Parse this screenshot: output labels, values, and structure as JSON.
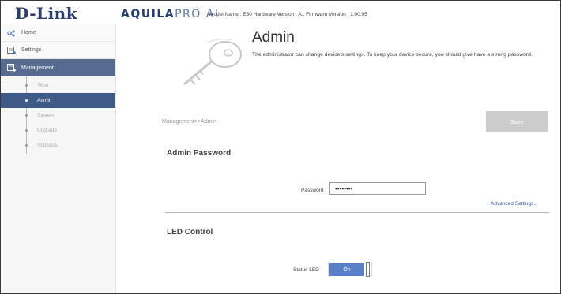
{
  "header": {
    "logo": "D-Link",
    "brand_main": "AQUILA",
    "brand_pro": "PRO AI",
    "model_info": "Model Name : E30 Hardware Version : A1 Firmware Version : 1.00.05"
  },
  "sidebar": {
    "items": [
      {
        "label": "Home",
        "icon": "home-icon"
      },
      {
        "label": "Settings",
        "icon": "settings-icon"
      },
      {
        "label": "Management",
        "icon": "management-icon"
      }
    ],
    "sub_items": [
      {
        "label": "Time"
      },
      {
        "label": "Admin"
      },
      {
        "label": "System"
      },
      {
        "label": "Upgrade"
      },
      {
        "label": "Statistics"
      }
    ]
  },
  "main": {
    "title": "Admin",
    "description": "The administrator can change device's settings. To keep your device secure, you should give have a strong password.",
    "breadcrumb": "Management>>Admin",
    "save_label": "Save",
    "admin_password_title": "Admin Password",
    "password_label": "Password",
    "password_value": "••••••••",
    "advanced_link": "Advanced Settings...",
    "led_title": "LED Control",
    "status_led_label": "Status LED",
    "status_led_value": "On"
  },
  "colors": {
    "sidebar_active": "#556b8f",
    "sub_active": "#3f5a86",
    "toggle_on": "#5a80c8",
    "save_disabled": "#cccccc",
    "brand": "#24416e"
  }
}
